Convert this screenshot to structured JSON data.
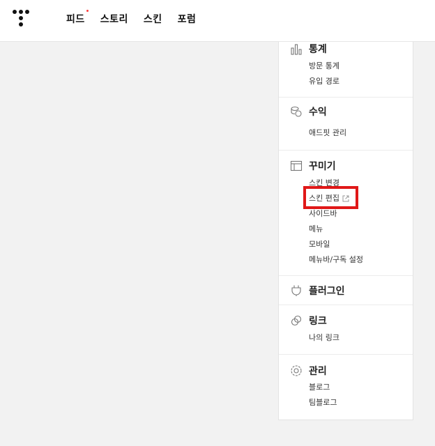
{
  "nav": {
    "items": [
      {
        "label": "피드",
        "has_dot": true
      },
      {
        "label": "스토리",
        "has_dot": false
      },
      {
        "label": "스킨",
        "has_dot": false
      },
      {
        "label": "포럼",
        "has_dot": false
      }
    ]
  },
  "sidebar": {
    "stats": {
      "title": "통계",
      "icon": "bar-chart-icon",
      "items": [
        "방문 통계",
        "유입 경로"
      ]
    },
    "revenue": {
      "title": "수익",
      "icon": "coins-icon",
      "items": [
        "애드핏 관리"
      ]
    },
    "design": {
      "title": "꾸미기",
      "icon": "layout-icon",
      "items": [
        "스킨 변경",
        "스킨 편집",
        "사이드바",
        "메뉴",
        "모바일",
        "메뉴바/구독 설정"
      ]
    },
    "plugin": {
      "title": "플러그인",
      "icon": "plug-icon"
    },
    "link": {
      "title": "링크",
      "icon": "link-icon",
      "items": [
        "나의 링크"
      ]
    },
    "manage": {
      "title": "관리",
      "icon": "gear-icon",
      "items": [
        "블로그",
        "팀블로그"
      ]
    }
  },
  "colors": {
    "highlight": "#e01818",
    "nav_dot": "#ff3a3a",
    "background": "#f2f2f2"
  }
}
